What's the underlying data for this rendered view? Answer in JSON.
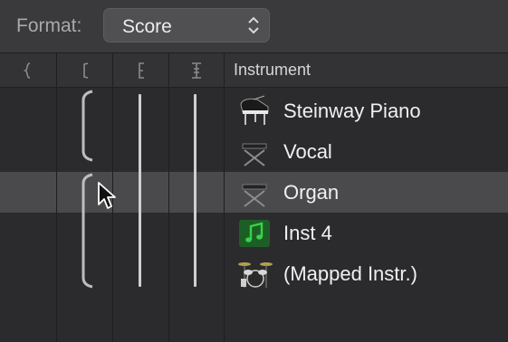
{
  "toolbar": {
    "format_label": "Format:",
    "format_value": "Score"
  },
  "columns": {
    "brace_icon": "{",
    "bracket_icon": "[",
    "subbracket_icon": "E",
    "barline_icon": "I",
    "instrument_header": "Instrument"
  },
  "instruments": [
    {
      "name": "Steinway Piano",
      "icon": "grand-piano-icon"
    },
    {
      "name": "Vocal",
      "icon": "keyboard-stand-icon"
    },
    {
      "name": "Organ",
      "icon": "keyboard-stand-icon"
    },
    {
      "name": "Inst 4",
      "icon": "music-note-icon"
    },
    {
      "name": "(Mapped Instr.)",
      "icon": "drum-kit-icon"
    }
  ],
  "selected_row": 2,
  "colors": {
    "background": "#2d2d2f",
    "selected_row": "#4a4a4c",
    "note_icon_green": "#3ad14a"
  }
}
